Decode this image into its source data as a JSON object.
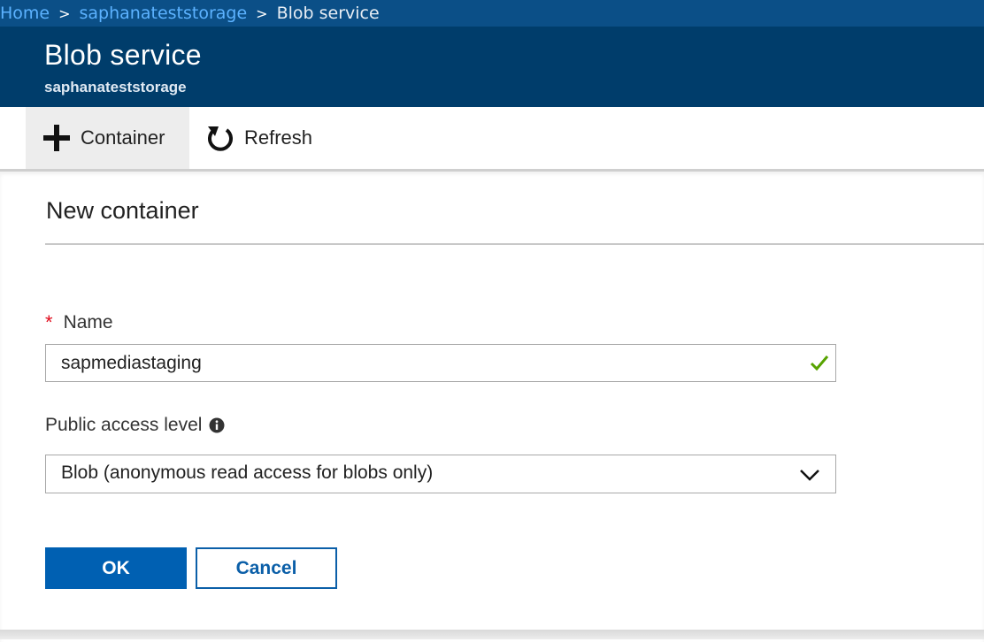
{
  "breadcrumb": {
    "items": [
      {
        "label": "Home"
      },
      {
        "label": "saphanateststorage"
      },
      {
        "label": "Blob service"
      }
    ]
  },
  "header": {
    "title": "Blob service",
    "subtitle": "saphanateststorage"
  },
  "toolbar": {
    "container_label": "Container",
    "refresh_label": "Refresh",
    "container_icon": "plus-icon",
    "refresh_icon": "refresh-icon"
  },
  "panel": {
    "title": "New container",
    "name_field": {
      "required_mark": "*",
      "label": "Name",
      "value": "sapmediastaging",
      "valid_icon": "checkmark-icon"
    },
    "access_field": {
      "label": "Public access level",
      "info_icon": "info-icon",
      "selected": "Blob (anonymous read access for blobs only)"
    },
    "ok_label": "OK",
    "cancel_label": "Cancel"
  },
  "colors": {
    "breadcrumb_bg": "#0b4f87",
    "header_bg": "#003d6b",
    "link": "#5cb2ff",
    "primary": "#0060b2",
    "required": "#e00b1c",
    "valid": "#57a300"
  }
}
